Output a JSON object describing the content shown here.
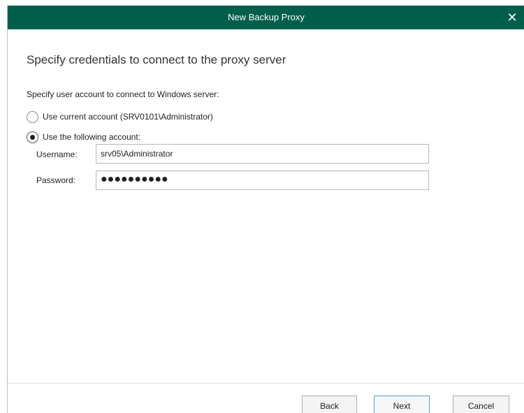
{
  "window": {
    "title": "New Backup Proxy",
    "close_glyph": "✕"
  },
  "content": {
    "heading": "Specify credentials to connect to the proxy server",
    "prompt": "Specify user account to connect to Windows server:",
    "options": [
      {
        "label": "Use current account (SRV0101\\Administrator)",
        "selected": false
      },
      {
        "label": "Use the following account:",
        "selected": true
      }
    ],
    "username": {
      "label": "Username:",
      "value": "srv05\\Administrator"
    },
    "password": {
      "label": "Password:",
      "value": "●●●●●●●●●●"
    }
  },
  "buttons": {
    "back": "Back",
    "next": "Next",
    "cancel": "Cancel"
  },
  "colors": {
    "titlebar": "#005f4b",
    "primary_border": "#5b9bd5"
  }
}
